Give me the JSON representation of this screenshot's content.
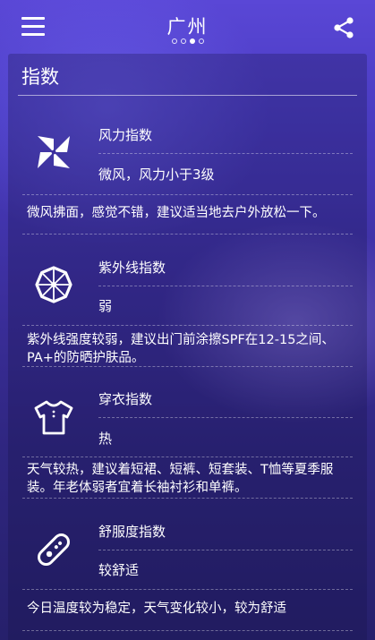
{
  "header": {
    "city": "广州",
    "page_dots": 4,
    "active_dot": 2,
    "menu_icon": "hamburger-menu-icon",
    "share_icon": "share-icon"
  },
  "panel": {
    "title": "指数",
    "sections": [
      {
        "name": "风力指数",
        "level": "微风，风力小于3级",
        "desc": "微风拂面，感觉不错，建议适当地去户外放松一下。",
        "icon": "pinwheel-icon"
      },
      {
        "name": "紫外线指数",
        "level": "弱",
        "desc": "紫外线强度较弱，建议出门前涂擦SPF在12-15之间、PA+的防晒护肤品。",
        "icon": "umbrella-icon"
      },
      {
        "name": "穿衣指数",
        "level": "热",
        "desc": "天气较热，建议着短裙、短裤、短套装、T恤等夏季服装。年老体弱者宜着长袖衬衫和单裤。",
        "icon": "tshirt-icon"
      },
      {
        "name": "舒服度指数",
        "level": "较舒适",
        "desc": "今日温度较为稳定，天气变化较小，较为舒适",
        "icon": "comfort-band-icon"
      }
    ]
  },
  "colors": {
    "background_top": "#5a47d6",
    "background_bottom": "#26206b",
    "text": "#ffffff"
  }
}
